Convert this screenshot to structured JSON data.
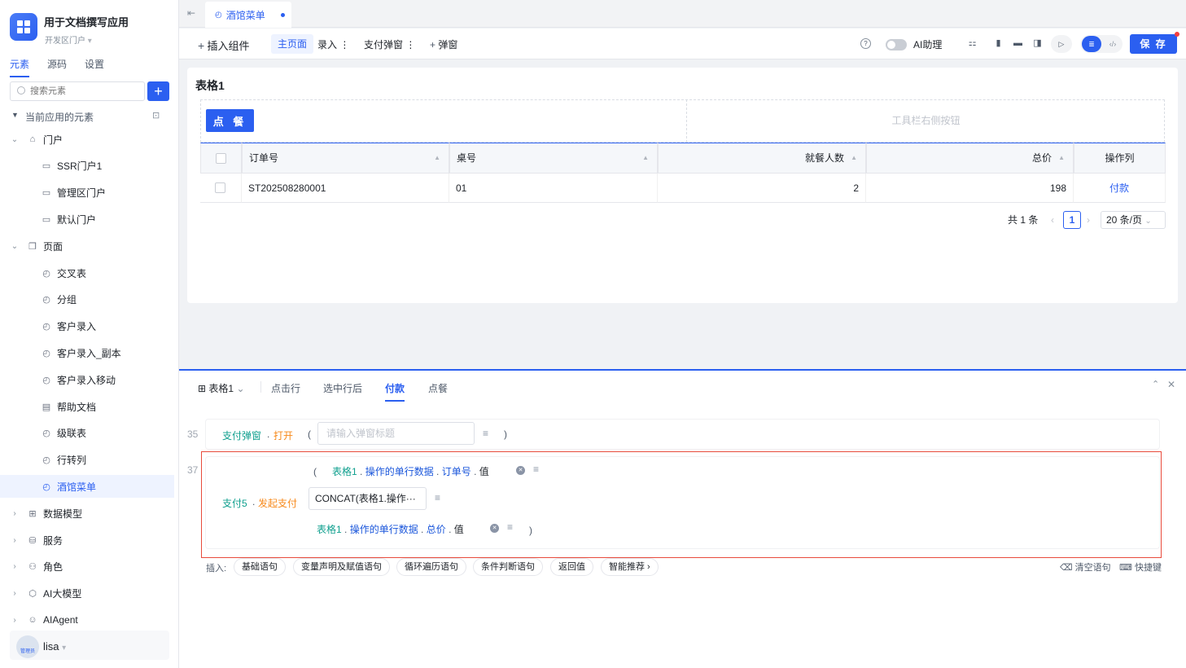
{
  "sidebar": {
    "app_title": "用于文档撰写应用",
    "app_subtitle": "开发区门户",
    "tabs": [
      "元素",
      "源码",
      "设置"
    ],
    "search_placeholder": "搜索元素",
    "section_title": "当前应用的元素",
    "tree": [
      {
        "label": "门户",
        "level": 0,
        "arrow": "⌄",
        "icon": "home-icon"
      },
      {
        "label": "SSR门户1",
        "level": 1,
        "icon": "portal-icon"
      },
      {
        "label": "管理区门户",
        "level": 1,
        "icon": "portal-icon"
      },
      {
        "label": "默认门户",
        "level": 1,
        "icon": "portal-icon"
      },
      {
        "label": "页面",
        "level": 0,
        "arrow": "⌄",
        "icon": "pages-icon"
      },
      {
        "label": "交叉表",
        "level": 1,
        "icon": "page-icon"
      },
      {
        "label": "分组",
        "level": 1,
        "icon": "page-icon"
      },
      {
        "label": "客户录入",
        "level": 1,
        "icon": "page-icon"
      },
      {
        "label": "客户录入_副本",
        "level": 1,
        "icon": "page-icon"
      },
      {
        "label": "客户录入移动",
        "level": 1,
        "icon": "page-icon"
      },
      {
        "label": "帮助文档",
        "level": 1,
        "icon": "doc-icon"
      },
      {
        "label": "级联表",
        "level": 1,
        "icon": "page-icon"
      },
      {
        "label": "行转列",
        "level": 1,
        "icon": "page-icon"
      },
      {
        "label": "酒馆菜单",
        "level": 1,
        "icon": "page-icon",
        "selected": true
      },
      {
        "label": "数据模型",
        "level": 0,
        "arrow": "›",
        "icon": "table-icon"
      },
      {
        "label": "服务",
        "level": 0,
        "arrow": "›",
        "icon": "service-icon"
      },
      {
        "label": "角色",
        "level": 0,
        "arrow": "›",
        "icon": "role-icon"
      },
      {
        "label": "AI大模型",
        "level": 0,
        "arrow": "›",
        "icon": "cube-icon"
      },
      {
        "label": "AIAgent",
        "level": 0,
        "arrow": "›",
        "icon": "robot-icon"
      }
    ],
    "user_name": "lisa",
    "avatar_text": "管理员"
  },
  "tabbar": {
    "active_tab": "酒馆菜单"
  },
  "toolbar": {
    "insert_component": "插入组件",
    "main_page": "主页面",
    "entry": "录入",
    "pay_popup": "支付弹窗",
    "add_popup": "弹窗",
    "ai_assistant": "AI助理",
    "save": "保 存"
  },
  "canvas": {
    "table_title": "表格1",
    "order_button": "点 餐",
    "toolbar_right_hint": "工具栏右侧按钮",
    "columns": [
      "订单号",
      "桌号",
      "就餐人数",
      "总价",
      "操作列"
    ],
    "rows": [
      {
        "order_no": "ST202508280001",
        "table_no": "01",
        "diners": "2",
        "total": "198",
        "action": "付款"
      }
    ],
    "pagination": {
      "total_text": "共 1 条",
      "current_page": "1",
      "page_size": "20 条/页"
    }
  },
  "logic_editor": {
    "tabs": {
      "source": "表格1",
      "click_row": "点击行",
      "after_select": "选中行后",
      "pay": "付款",
      "order": "点餐"
    },
    "line35": {
      "number": "35",
      "obj": "支付弹窗",
      "method": "打开",
      "placeholder": "请输入弹窗标题"
    },
    "line37": {
      "number": "37",
      "obj": "支付5",
      "method": "发起支付",
      "arg1_obj": "表格1",
      "arg1_path": "操作的单行数据",
      "arg1_field": "订单号",
      "arg1_value": "值",
      "arg2_concat": "CONCAT(表格1.操作···",
      "arg3_obj": "表格1",
      "arg3_path": "操作的单行数据",
      "arg3_field": "总价",
      "arg3_value": "值"
    },
    "insert_label": "插入:",
    "insert_buttons": [
      "基础语句",
      "变量声明及赋值语句",
      "循环遍历语句",
      "条件判断语句",
      "返回值",
      "智能推荐 ›"
    ],
    "clear_label": "清空语句",
    "shortcut_label": "快捷键"
  }
}
